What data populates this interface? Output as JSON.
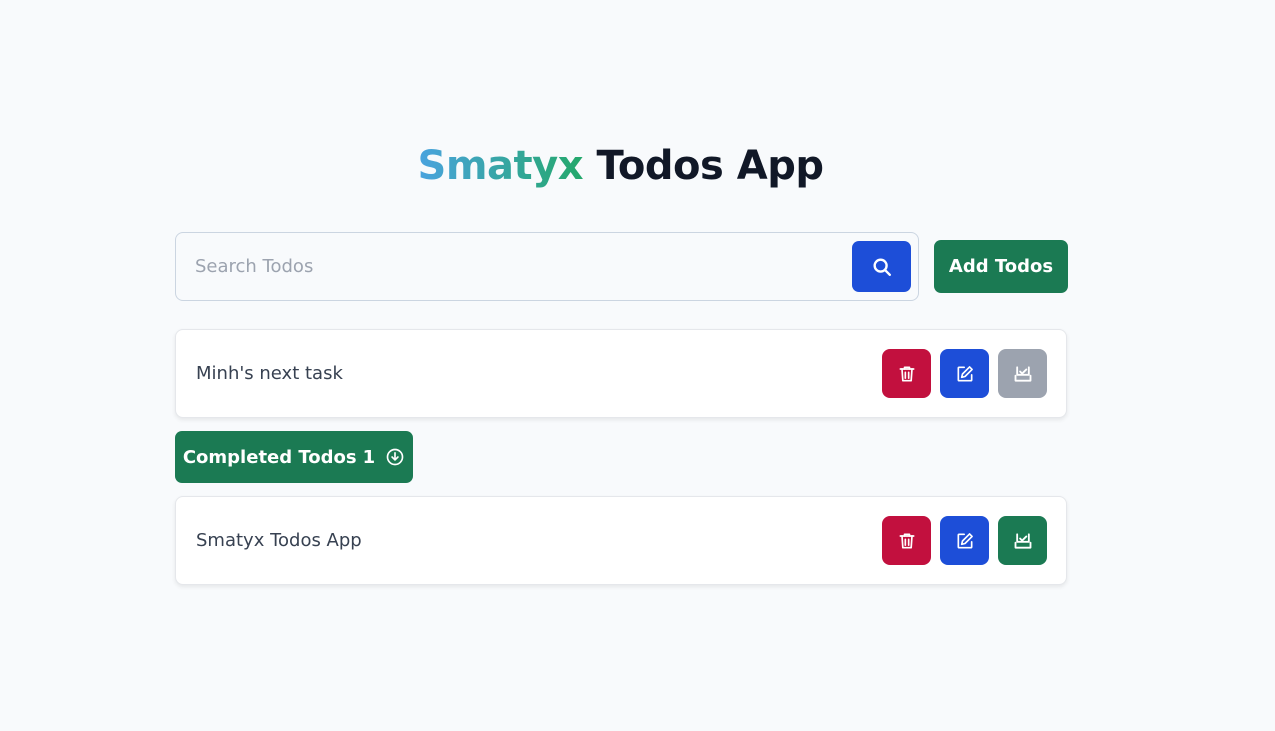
{
  "header": {
    "brand": "Smatyx",
    "title_rest": "Todos App"
  },
  "search": {
    "placeholder": "Search Todos",
    "value": "",
    "icon": "search-icon"
  },
  "add_button": {
    "label": "Add Todos"
  },
  "todos": [
    {
      "text": "Minh's next task",
      "status": "pending"
    }
  ],
  "completed_section": {
    "label": "Completed Todos",
    "count": "1",
    "icon": "chevron-circle-down-icon"
  },
  "completed_todos": [
    {
      "text": "Smatyx Todos App",
      "status": "completed"
    }
  ],
  "action_icons": {
    "delete": "trash-icon",
    "edit": "edit-icon",
    "complete": "tray-check-icon"
  },
  "colors": {
    "background": "#f8fafc",
    "brand_gradient_start": "#4aa3df",
    "brand_gradient_end": "#24a86b",
    "primary_blue": "#1d4ed8",
    "success_green": "#1b7a53",
    "danger_red": "#c2103e",
    "muted_gray": "#9ca3af"
  }
}
